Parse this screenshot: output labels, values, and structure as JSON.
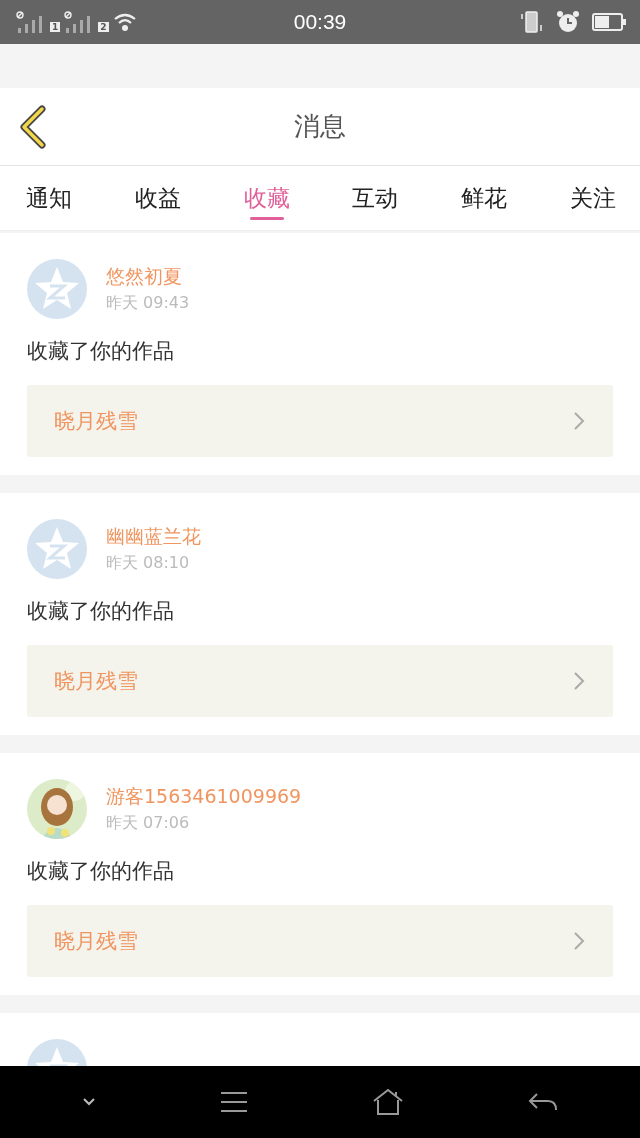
{
  "status_bar": {
    "time": "00:39",
    "sim_labels": [
      "1",
      "2"
    ]
  },
  "header": {
    "title": "消息"
  },
  "tabs": [
    {
      "label": "通知",
      "selected": false
    },
    {
      "label": "收益",
      "selected": false
    },
    {
      "label": "收藏",
      "selected": true
    },
    {
      "label": "互动",
      "selected": false
    },
    {
      "label": "鲜花",
      "selected": false
    },
    {
      "label": "关注",
      "selected": false
    }
  ],
  "messages": [
    {
      "avatar": {
        "kind": "default"
      },
      "name": "悠然初夏",
      "time": "昨天 09:43",
      "text": "收藏了你的作品",
      "work": "晓月残雪"
    },
    {
      "avatar": {
        "kind": "default"
      },
      "name": "幽幽蓝兰花",
      "time": "昨天 08:10",
      "text": "收藏了你的作品",
      "work": "晓月残雪"
    },
    {
      "name": "游客1563461009969",
      "time": "昨天 07:06",
      "text": "收藏了你的作品",
      "work": "晓月残雪"
    },
    {
      "avatar": {
        "kind": "default"
      }
    }
  ]
}
